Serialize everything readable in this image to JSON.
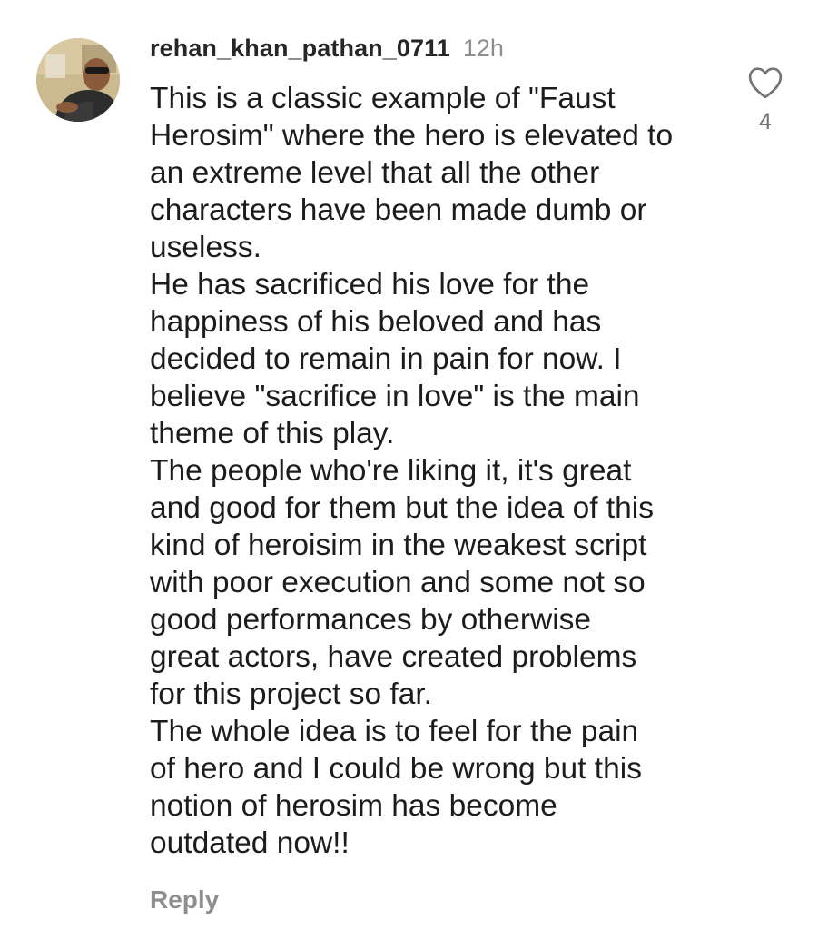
{
  "comment": {
    "username": "rehan_khan_pathan_0711",
    "time": "12h",
    "lines": [
      "This is a classic example of \"Faust",
      "Herosim\" where the hero is elevated to",
      "an extreme level that all the other",
      "characters have been made dumb or",
      "useless.",
      "He has sacrificed his love for the",
      "happiness of his beloved and has",
      "decided to remain in pain for now. I",
      "believe \"sacrifice in love\" is the main",
      "theme of this play.",
      "The people who're liking it, it's great",
      "and good for them but the idea of this",
      "kind of heroisim in the weakest script",
      "with poor execution and some not so",
      "good performances by otherwise",
      "great actors, have created problems",
      "for this project so far.",
      "The whole idea is to feel for the pain",
      "of hero and I could be wrong but this",
      "notion of herosim has become",
      "outdated now!!"
    ],
    "like_count": "4",
    "like_icon": "heart-outline-icon",
    "reply_label": "Reply"
  },
  "colors": {
    "username": "#262626",
    "secondary": "#8e8e8e",
    "text": "#1c1c1c"
  }
}
